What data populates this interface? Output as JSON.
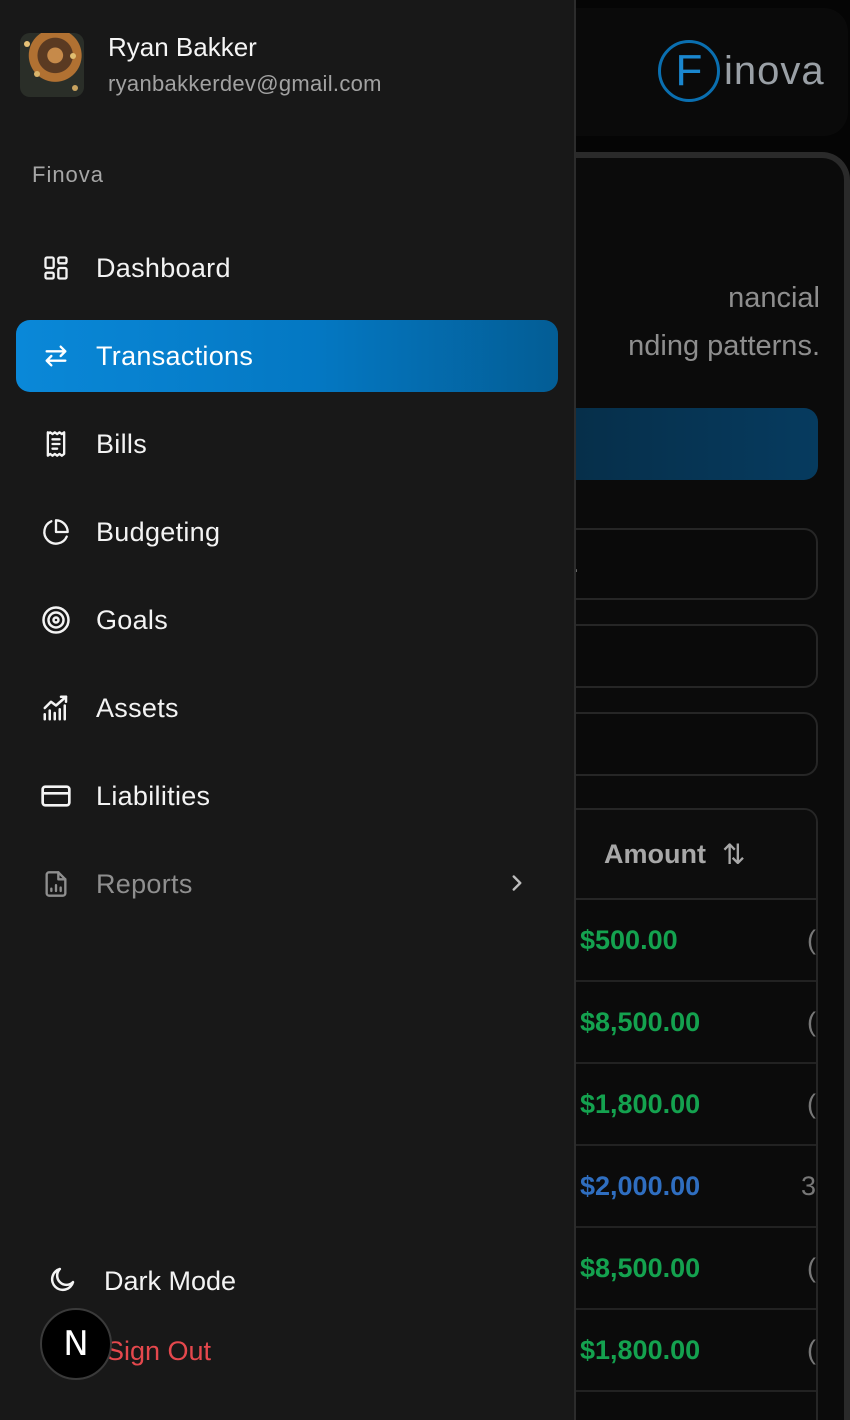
{
  "background": {
    "logo": {
      "letter": "F",
      "rest": "inova"
    },
    "description_line1": "nancial",
    "description_line2": "nding patterns.",
    "search_placeholder": ".",
    "table": {
      "amount_header": "Amount",
      "sort_icon": "sort-arrows-icon",
      "rows": [
        {
          "amount": "$500.00",
          "color": "#14a24f",
          "cut": "("
        },
        {
          "amount": "$8,500.00",
          "color": "#14a24f",
          "cut": "("
        },
        {
          "amount": "$1,800.00",
          "color": "#14a24f",
          "cut": "("
        },
        {
          "amount": "$2,000.00",
          "color": "#2f6ec0",
          "cut": "3"
        },
        {
          "amount": "$8,500.00",
          "color": "#14a24f",
          "cut": "("
        },
        {
          "amount": "$1,800.00",
          "color": "#14a24f",
          "cut": "("
        }
      ]
    }
  },
  "user": {
    "name": "Ryan Bakker",
    "email": "ryanbakkerdev@gmail.com"
  },
  "section_label": "Finova",
  "nav": {
    "items": [
      {
        "label": "Dashboard",
        "icon": "dashboard-grid-icon"
      },
      {
        "label": "Transactions",
        "icon": "arrows-left-right-icon",
        "active": true
      },
      {
        "label": "Bills",
        "icon": "receipt-icon"
      },
      {
        "label": "Budgeting",
        "icon": "pie-chart-icon"
      },
      {
        "label": "Goals",
        "icon": "target-icon"
      },
      {
        "label": "Assets",
        "icon": "chart-bars-trend-icon"
      },
      {
        "label": "Liabilities",
        "icon": "credit-card-icon"
      },
      {
        "label": "Reports",
        "icon": "file-chart-icon",
        "muted": true,
        "has_submenu": true
      }
    ]
  },
  "footer": {
    "dark_mode_label": "Dark Mode",
    "sign_out_label": "Sign Out",
    "badge_letter": "N"
  },
  "colors": {
    "accent": "#0a88d8",
    "drawer_bg": "#181818",
    "danger": "#e5484d",
    "positive": "#14a24f"
  }
}
